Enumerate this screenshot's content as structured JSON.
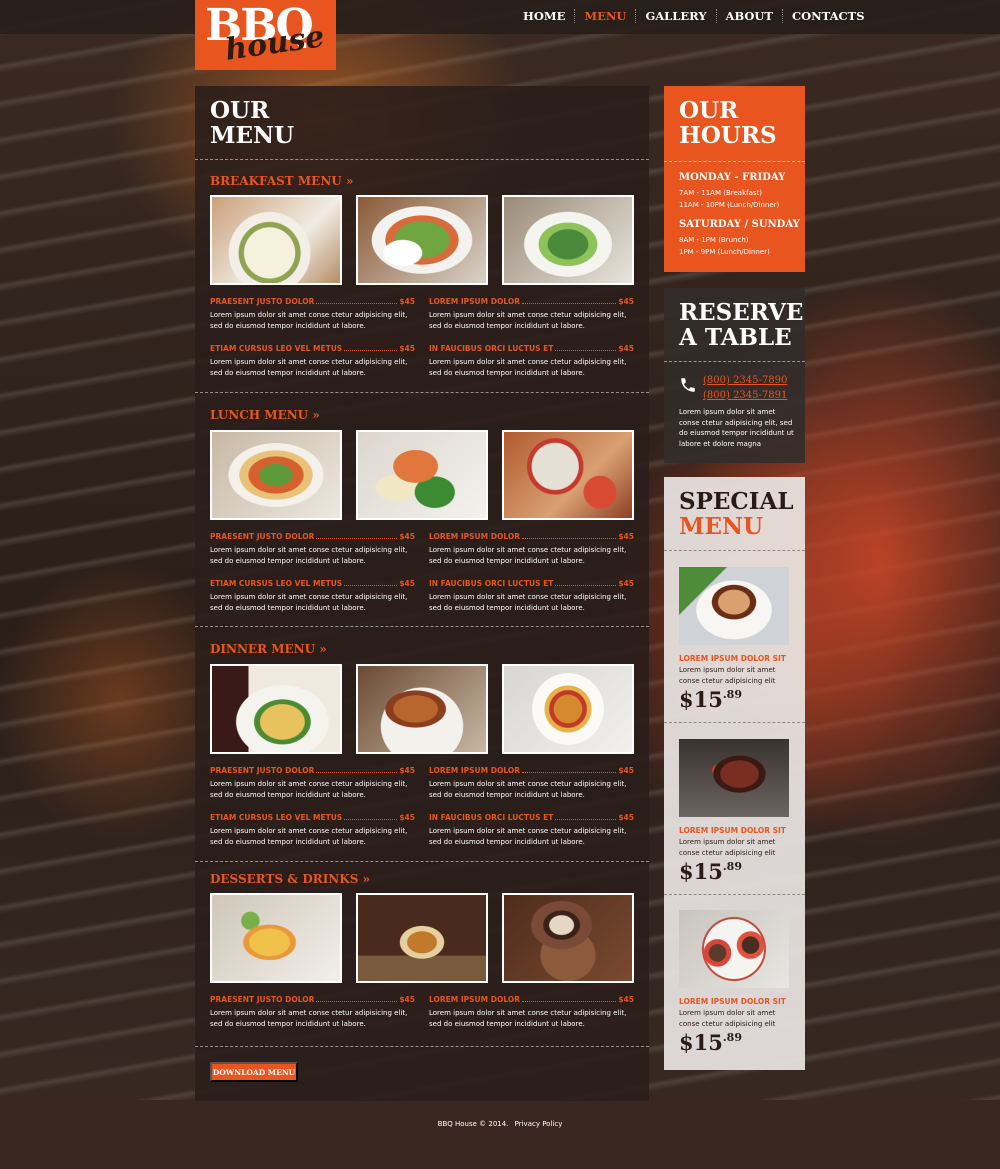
{
  "brand": {
    "logo_main": "BBQ",
    "logo_script": "house"
  },
  "nav": [
    {
      "label": "HOME",
      "active": false
    },
    {
      "label": "MENU",
      "active": true
    },
    {
      "label": "GALLERY",
      "active": false
    },
    {
      "label": "ABOUT",
      "active": false
    },
    {
      "label": "CONTACTS",
      "active": false
    }
  ],
  "main": {
    "title_line1": "OUR",
    "title_line2": "MENU",
    "sections": [
      {
        "title": "BREAKFAST MENU »",
        "items": [
          {
            "name": "PRAESENT JUSTO DOLOR",
            "price": "$45",
            "desc": "Lorem ipsum dolor sit amet conse ctetur adipisicing elit, sed do eiusmod tempor incididunt ut labore."
          },
          {
            "name": "LOREM IPSUM DOLOR",
            "price": "$45",
            "desc": "Lorem ipsum dolor sit amet conse ctetur adipisicing elit, sed do eiusmod tempor incididunt ut labore."
          },
          {
            "name": "ETIAM CURSUS LEO VEL METUS",
            "price": "$45",
            "desc": "Lorem ipsum dolor sit amet conse ctetur adipisicing elit, sed do eiusmod tempor incididunt ut labore."
          },
          {
            "name": "IN FAUCIBUS ORCI LUCTUS ET",
            "price": "$45",
            "desc": "Lorem ipsum dolor sit amet conse ctetur adipisicing elit, sed do eiusmod tempor incididunt ut labore."
          }
        ]
      },
      {
        "title": "LUNCH MENU »",
        "items": [
          {
            "name": "PRAESENT JUSTO DOLOR",
            "price": "$45",
            "desc": "Lorem ipsum dolor sit amet conse ctetur adipisicing elit, sed do eiusmod tempor incididunt ut labore."
          },
          {
            "name": "LOREM IPSUM DOLOR",
            "price": "$45",
            "desc": "Lorem ipsum dolor sit amet conse ctetur adipisicing elit, sed do eiusmod tempor incididunt ut labore."
          },
          {
            "name": "ETIAM CURSUS LEO VEL METUS",
            "price": "$45",
            "desc": "Lorem ipsum dolor sit amet conse ctetur adipisicing elit, sed do eiusmod tempor incididunt ut labore."
          },
          {
            "name": "IN FAUCIBUS ORCI LUCTUS ET",
            "price": "$45",
            "desc": "Lorem ipsum dolor sit amet conse ctetur adipisicing elit, sed do eiusmod tempor incididunt ut labore."
          }
        ]
      },
      {
        "title": "DINNER MENU »",
        "items": [
          {
            "name": "PRAESENT JUSTO DOLOR",
            "price": "$45",
            "desc": "Lorem ipsum dolor sit amet conse ctetur adipisicing elit, sed do eiusmod tempor incididunt ut labore."
          },
          {
            "name": "LOREM IPSUM DOLOR",
            "price": "$45",
            "desc": "Lorem ipsum dolor sit amet conse ctetur adipisicing elit, sed do eiusmod tempor incididunt ut labore."
          },
          {
            "name": "ETIAM CURSUS LEO VEL METUS",
            "price": "$45",
            "desc": "Lorem ipsum dolor sit amet conse ctetur adipisicing elit, sed do eiusmod tempor incididunt ut labore."
          },
          {
            "name": "IN FAUCIBUS ORCI LUCTUS ET",
            "price": "$45",
            "desc": "Lorem ipsum dolor sit amet conse ctetur adipisicing elit, sed do eiusmod tempor incididunt ut labore."
          }
        ]
      },
      {
        "title": "DESSERTS & DRINKS »",
        "items": [
          {
            "name": "PRAESENT JUSTO DOLOR",
            "price": "$45",
            "desc": "Lorem ipsum dolor sit amet conse ctetur adipisicing elit, sed do eiusmod tempor incididunt ut labore."
          },
          {
            "name": "LOREM IPSUM DOLOR",
            "price": "$45",
            "desc": "Lorem ipsum dolor sit amet conse ctetur adipisicing elit, sed do eiusmod tempor incididunt ut labore."
          }
        ]
      }
    ],
    "download_label": "DOWNLOAD MENU"
  },
  "hours": {
    "title_line1": "OUR",
    "title_line2": "HOURS",
    "weekday_heading": "MONDAY - FRIDAY",
    "weekday_line1": "7AM - 11AM (Breakfast)",
    "weekday_line2": "11AM - 10PM (Lunch/Dinner)",
    "weekend_heading": "SATURDAY / SUNDAY",
    "weekend_line1": "8AM - 1PM (Brunch)",
    "weekend_line2": "1PM - 9PM (Lunch/Dinner)"
  },
  "reserve": {
    "title_line1": "RESERVE",
    "title_line2": "A TABLE",
    "phone1": "(800) 2345-7890",
    "phone2": "(800) 2345-7891",
    "desc": "Lorem ipsum dolor sit amet conse ctetur adipisicing elit, sed do eiusmod tempor incididunt ut labore et dolore magna"
  },
  "special": {
    "title_line1": "SPECIAL",
    "title_line2": "MENU",
    "items": [
      {
        "name": "LOREM IPSUM DOLOR SIT",
        "desc": "Lorem ipsum dolor sit amet conse ctetur adipisicing elit",
        "price_main": "$15",
        "price_cents": ".89"
      },
      {
        "name": "LOREM IPSUM DOLOR SIT",
        "desc": "Lorem ipsum dolor sit amet conse ctetur adipisicing elit",
        "price_main": "$15",
        "price_cents": ".89"
      },
      {
        "name": "LOREM IPSUM DOLOR SIT",
        "desc": "Lorem ipsum dolor sit amet conse ctetur adipisicing elit",
        "price_main": "$15",
        "price_cents": ".89"
      }
    ]
  },
  "footer": {
    "copyright": "BBQ House © 2014.",
    "privacy_label": "Privacy Policy"
  },
  "colors": {
    "accent": "#e8551f",
    "panel": "#2a1e1a",
    "special_bg": "#e8e4e2"
  }
}
